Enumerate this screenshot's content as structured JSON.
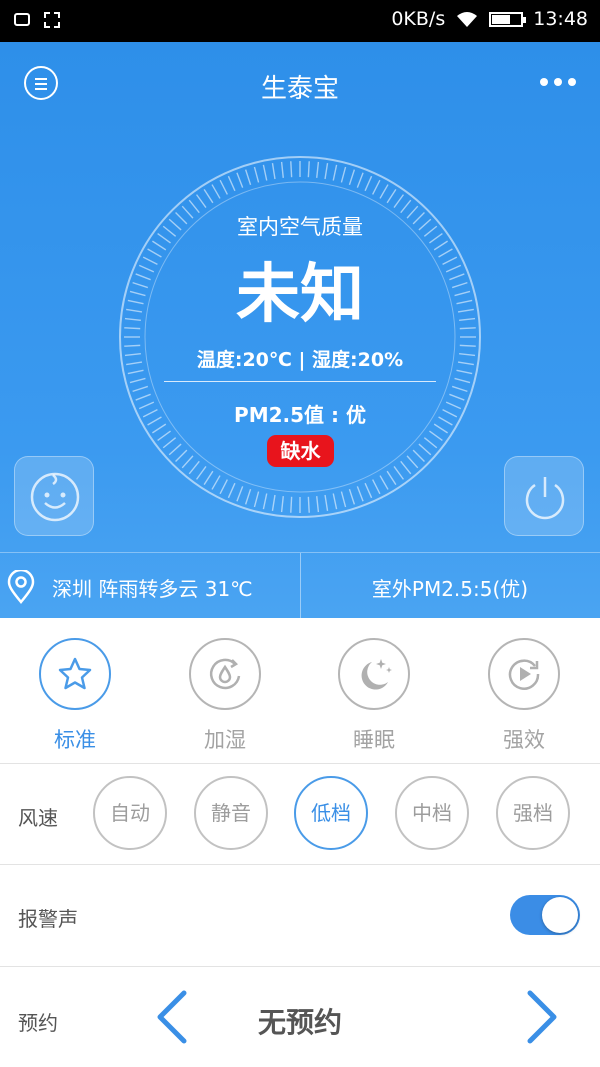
{
  "status_bar": {
    "network_speed": "0KB/s",
    "time": "13:48"
  },
  "header": {
    "title": "生泰宝"
  },
  "dial": {
    "label": "室内空气质量",
    "value": "未知",
    "climate": "温度:20℃ | 湿度:20%",
    "pm25": "PM2.5值 : 优",
    "warning_badge": "缺水"
  },
  "info_bar": {
    "weather": "深圳  阵雨转多云 31℃",
    "outdoor_pm25": "室外PM2.5:5(优)"
  },
  "modes": [
    {
      "label": "标准",
      "icon": "star-icon",
      "active": true
    },
    {
      "label": "加湿",
      "icon": "humidify-icon",
      "active": false
    },
    {
      "label": "睡眠",
      "icon": "moon-stars-icon",
      "active": false
    },
    {
      "label": "强效",
      "icon": "boost-icon",
      "active": false
    }
  ],
  "fan_speed": {
    "label": "风速",
    "options": [
      "自动",
      "静音",
      "低档",
      "中档",
      "强档"
    ],
    "selected": "低档"
  },
  "alarm": {
    "label": "报警声",
    "enabled": true
  },
  "schedule": {
    "label": "预约",
    "value": "无预约"
  },
  "colors": {
    "accent": "#3a8fe6",
    "header_bg": "#2e8fe9",
    "badge_red": "#e8141c",
    "inactive_gray": "#a3a3a3"
  }
}
